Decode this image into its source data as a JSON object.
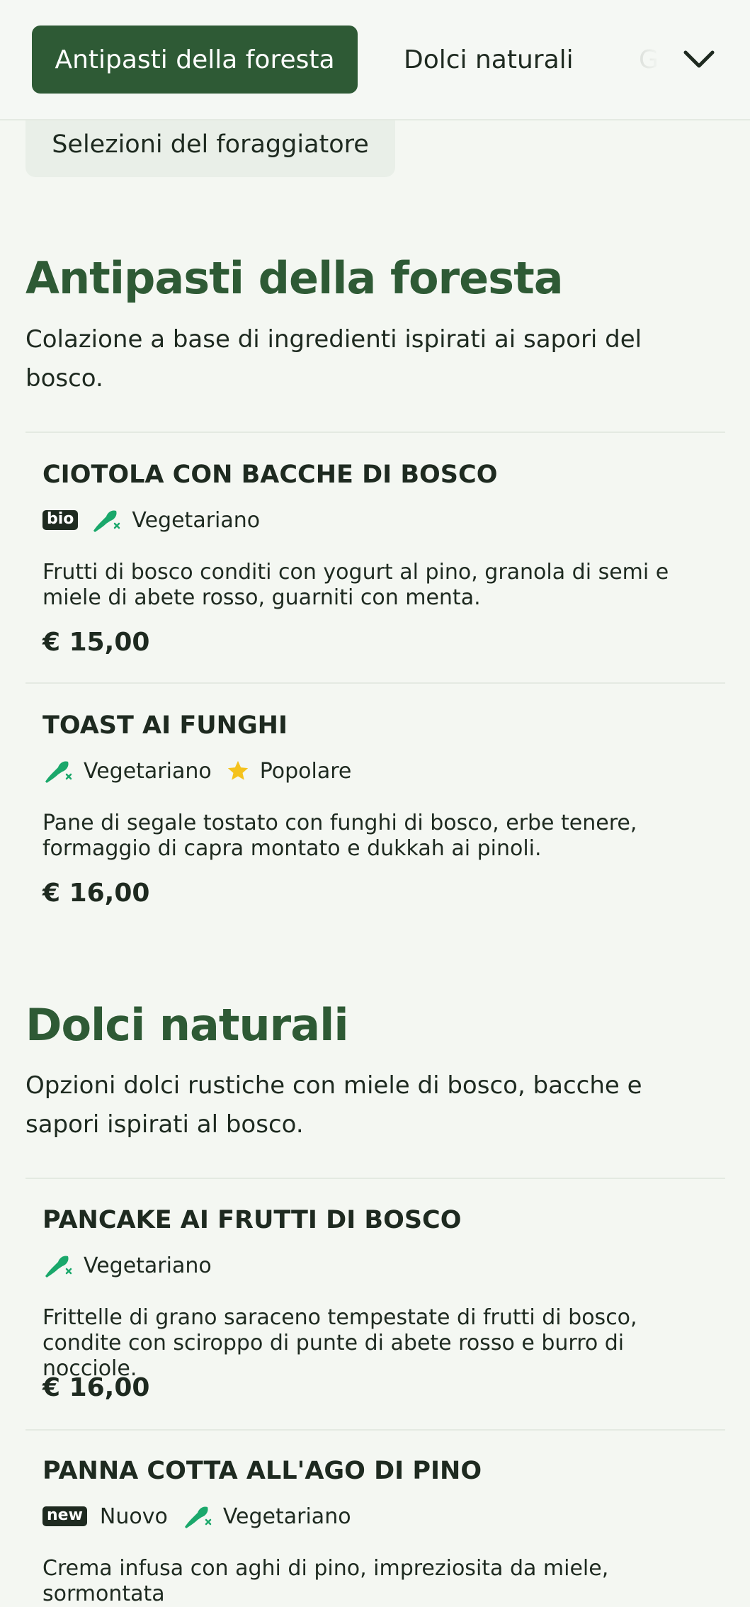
{
  "nav": {
    "tabs": [
      {
        "label": "Antipasti della foresta",
        "active": true
      },
      {
        "label": "Dolci naturali",
        "active": false
      },
      {
        "label": "Gi",
        "active": false
      }
    ],
    "subchip": "Selezioni del foraggiatore",
    "expand_icon": "chevron-down-icon"
  },
  "colors": {
    "brand_green": "#2e5a35",
    "veg_green": "#1aa86b",
    "star": "#f4c21d",
    "background": "#f4f7f2"
  },
  "sections": [
    {
      "title": "Antipasti della foresta",
      "description": "Colazione a base di ingredienti ispirati ai sapori del bosco.",
      "items": [
        {
          "name": "CIOTOLA CON BACCHE DI BOSCO",
          "badge": "bio",
          "tags": [
            "Vegetariano"
          ],
          "description": "Frutti di bosco conditi con yogurt al pino, granola di semi e miele di abete rosso, guarniti con menta.",
          "price": "€ 15,00"
        },
        {
          "name": "TOAST AI FUNGHI",
          "tags": [
            "Vegetariano",
            "Popolare"
          ],
          "description": "Pane di segale tostato con funghi di bosco, erbe tenere, formaggio di capra montato e dukkah ai pinoli.",
          "price": "€ 16,00"
        }
      ]
    },
    {
      "title": "Dolci naturali",
      "description": "Opzioni dolci rustiche con miele di bosco, bacche e sapori ispirati al bosco.",
      "items": [
        {
          "name": "PANCAKE AI FRUTTI DI BOSCO",
          "tags": [
            "Vegetariano"
          ],
          "description": "Frittelle di grano saraceno tempestate di frutti di bosco, condite con sciroppo di punte di abete rosso e burro di nocciole.",
          "price": "€ 16,00"
        },
        {
          "name": "PANNA COTTA ALL'AGO DI PINO",
          "badge": "new",
          "tags": [
            "Nuovo",
            "Vegetariano"
          ],
          "description": "Crema infusa con aghi di pino, impreziosita da miele, sormontata"
        }
      ]
    }
  ]
}
